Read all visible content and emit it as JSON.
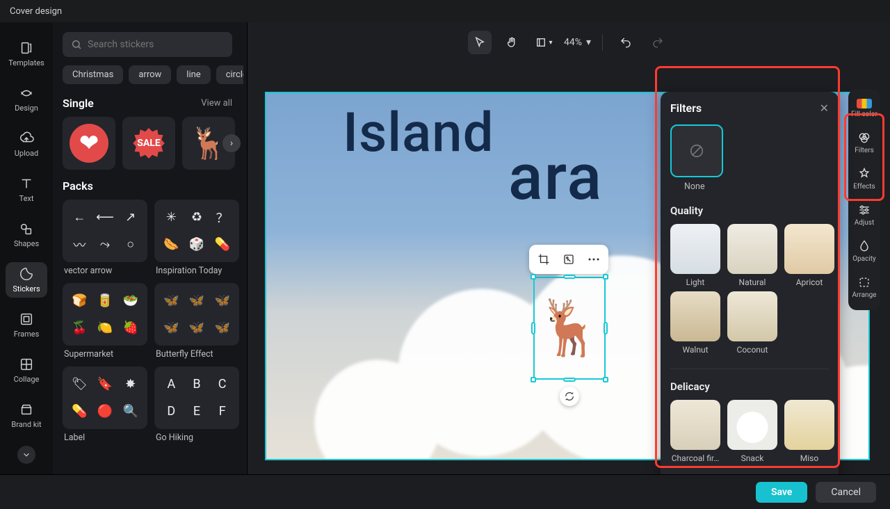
{
  "window": {
    "title": "Cover design"
  },
  "toolrail": {
    "items": [
      {
        "label": "Templates",
        "icon": "templates"
      },
      {
        "label": "Design",
        "icon": "design"
      },
      {
        "label": "Upload",
        "icon": "upload"
      },
      {
        "label": "Text",
        "icon": "text"
      },
      {
        "label": "Shapes",
        "icon": "shapes"
      },
      {
        "label": "Stickers",
        "icon": "stickers",
        "active": true
      },
      {
        "label": "Frames",
        "icon": "frames"
      },
      {
        "label": "Collage",
        "icon": "collage"
      },
      {
        "label": "Brand kit",
        "icon": "brandkit"
      }
    ]
  },
  "stickers_panel": {
    "search_placeholder": "Search stickers",
    "chips": [
      "Christmas",
      "arrow",
      "line",
      "circle"
    ],
    "single": {
      "title": "Single",
      "view_all": "View all"
    },
    "packs_title": "Packs",
    "packs": [
      {
        "label": "vector arrow"
      },
      {
        "label": "Inspiration Today"
      },
      {
        "label": "Supermarket"
      },
      {
        "label": "Butterfly Effect"
      },
      {
        "label": "Label"
      },
      {
        "label": "Go Hiking"
      }
    ]
  },
  "canvas": {
    "zoom": "44%",
    "headline_line1": "Island",
    "headline_line2": "ara"
  },
  "filters_panel": {
    "title": "Filters",
    "none_label": "None",
    "sections": [
      {
        "title": "Quality",
        "items": [
          "Light",
          "Natural",
          "Apricot",
          "Walnut",
          "Coconut"
        ]
      },
      {
        "title": "Delicacy",
        "items": [
          "Charcoal fir…",
          "Snack",
          "Miso"
        ]
      }
    ]
  },
  "prop_rail": {
    "items": [
      "Fill color",
      "Filters",
      "Effects",
      "Adjust",
      "Opacity",
      "Arrange"
    ]
  },
  "bottom": {
    "save": "Save",
    "cancel": "Cancel"
  }
}
